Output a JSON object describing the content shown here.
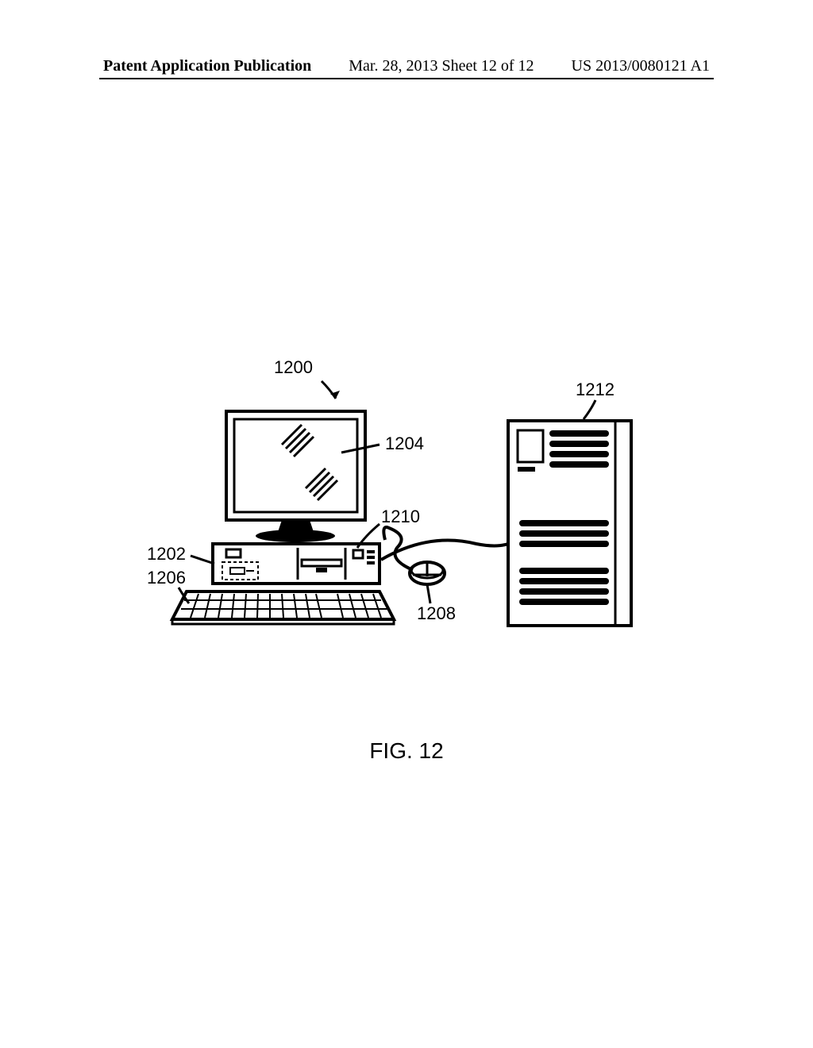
{
  "header": {
    "left": "Patent Application Publication",
    "center": "Mar. 28, 2013 Sheet 12 of 12",
    "right": "US 2013/0080121 A1"
  },
  "figure": {
    "caption": "FIG. 12",
    "labels": {
      "l1200": "1200",
      "l1212": "1212",
      "l1204": "1204",
      "l1210": "1210",
      "l1202": "1202",
      "l1206": "1206",
      "l1208": "1208"
    }
  }
}
